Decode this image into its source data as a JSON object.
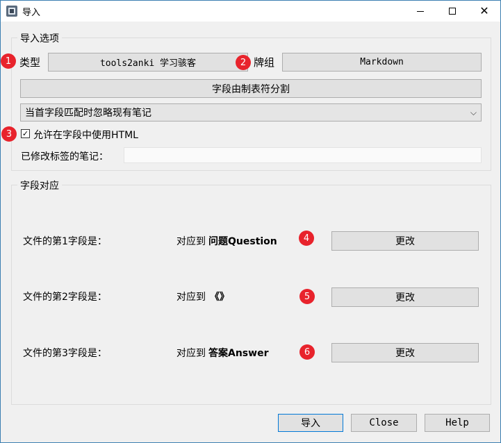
{
  "window": {
    "title": "导入"
  },
  "import_options": {
    "group_title": "导入选项",
    "type_label": "类型",
    "type_value": "tools2anki 学习骇客",
    "deck_label": "牌组",
    "deck_value": "Markdown",
    "separator_button": "字段由制表符分割",
    "duplicate_mode": "当首字段匹配时忽略现有笔记",
    "allow_html_label": "允许在字段中使用HTML",
    "allow_html_checked": true,
    "tag_modified_label": "已修改标签的笔记：",
    "tag_modified_value": ""
  },
  "field_mapping": {
    "group_title": "字段对应",
    "rows": [
      {
        "file_field": "文件的第1字段是：",
        "maps_to_prefix": "对应到",
        "target": "问题Question",
        "change_label": "更改",
        "badge": "4"
      },
      {
        "file_field": "文件的第2字段是：",
        "maps_to_prefix": "对应到",
        "target": "《》",
        "change_label": "更改",
        "badge": "5"
      },
      {
        "file_field": "文件的第3字段是：",
        "maps_to_prefix": "对应到",
        "target": "答案Answer",
        "change_label": "更改",
        "badge": "6"
      }
    ]
  },
  "badges": {
    "type": "1",
    "deck": "2",
    "html": "3"
  },
  "footer": {
    "import_label": "导入",
    "close_label": "Close",
    "help_label": "Help"
  },
  "colors": {
    "badge_red": "#e8232c",
    "accent_blue": "#0078d7"
  }
}
